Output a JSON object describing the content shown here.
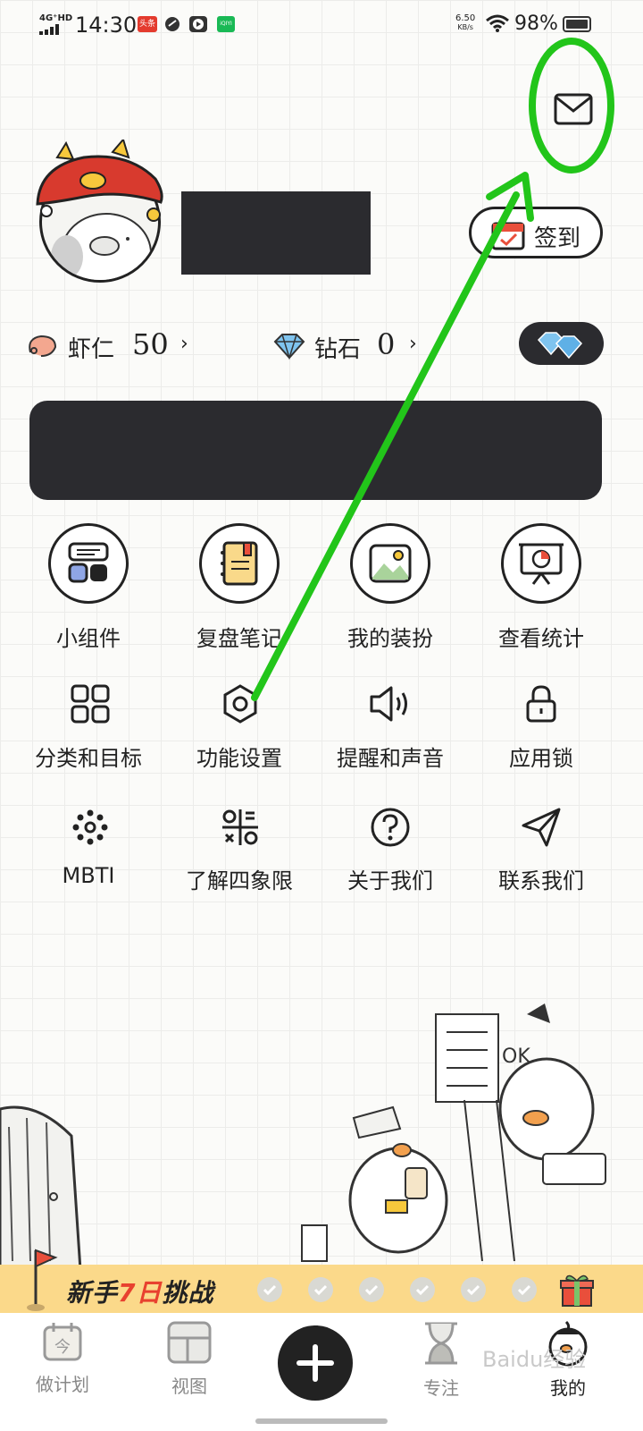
{
  "status_bar": {
    "network": "4G⁺HD",
    "time": "14:30",
    "apps": [
      "头条",
      "",
      "",
      "iQIYI"
    ],
    "speed_value": "6.50",
    "speed_unit": "KB/s",
    "battery": "98%"
  },
  "profile": {
    "checkin_label": "签到"
  },
  "currency": {
    "shrimp_label": "虾仁",
    "shrimp_value": "50",
    "diamond_label": "钻石",
    "diamond_value": "0",
    "chevron": "›"
  },
  "features": [
    {
      "label": "小组件",
      "icon": "widget-icon"
    },
    {
      "label": "复盘笔记",
      "icon": "notebook-icon"
    },
    {
      "label": "我的装扮",
      "icon": "picture-icon"
    },
    {
      "label": "查看统计",
      "icon": "presentation-chart-icon"
    }
  ],
  "settings_row1": [
    {
      "label": "分类和目标",
      "icon": "grid-icon"
    },
    {
      "label": "功能设置",
      "icon": "hexagon-settings-icon"
    },
    {
      "label": "提醒和声音",
      "icon": "speaker-icon"
    },
    {
      "label": "应用锁",
      "icon": "lock-icon"
    }
  ],
  "settings_row2": [
    {
      "label": "MBTI",
      "icon": "dots-flower-icon"
    },
    {
      "label": "了解四象限",
      "icon": "quadrant-icon"
    },
    {
      "label": "关于我们",
      "icon": "question-icon"
    },
    {
      "label": "联系我们",
      "icon": "paper-plane-icon"
    }
  ],
  "challenge": {
    "prefix": "新手",
    "highlight": "7日",
    "suffix": "挑战",
    "steps_total": 6,
    "steps_done": 0
  },
  "illustration": {
    "sign_text": "OK"
  },
  "nav": [
    {
      "label": "做计划",
      "icon": "calendar-icon",
      "icon_text": "今"
    },
    {
      "label": "视图",
      "icon": "layout-icon"
    },
    {
      "label": "",
      "icon": "plus-icon"
    },
    {
      "label": "专注",
      "icon": "hourglass-icon"
    },
    {
      "label": "我的",
      "icon": "duck-icon"
    }
  ],
  "watermark": "Baidu经验",
  "colors": {
    "accent_dark": "#2b2b2f",
    "challenge_bg": "#fbd98a",
    "challenge_highlight": "#e8412f",
    "annotation_green": "#22c51a"
  }
}
